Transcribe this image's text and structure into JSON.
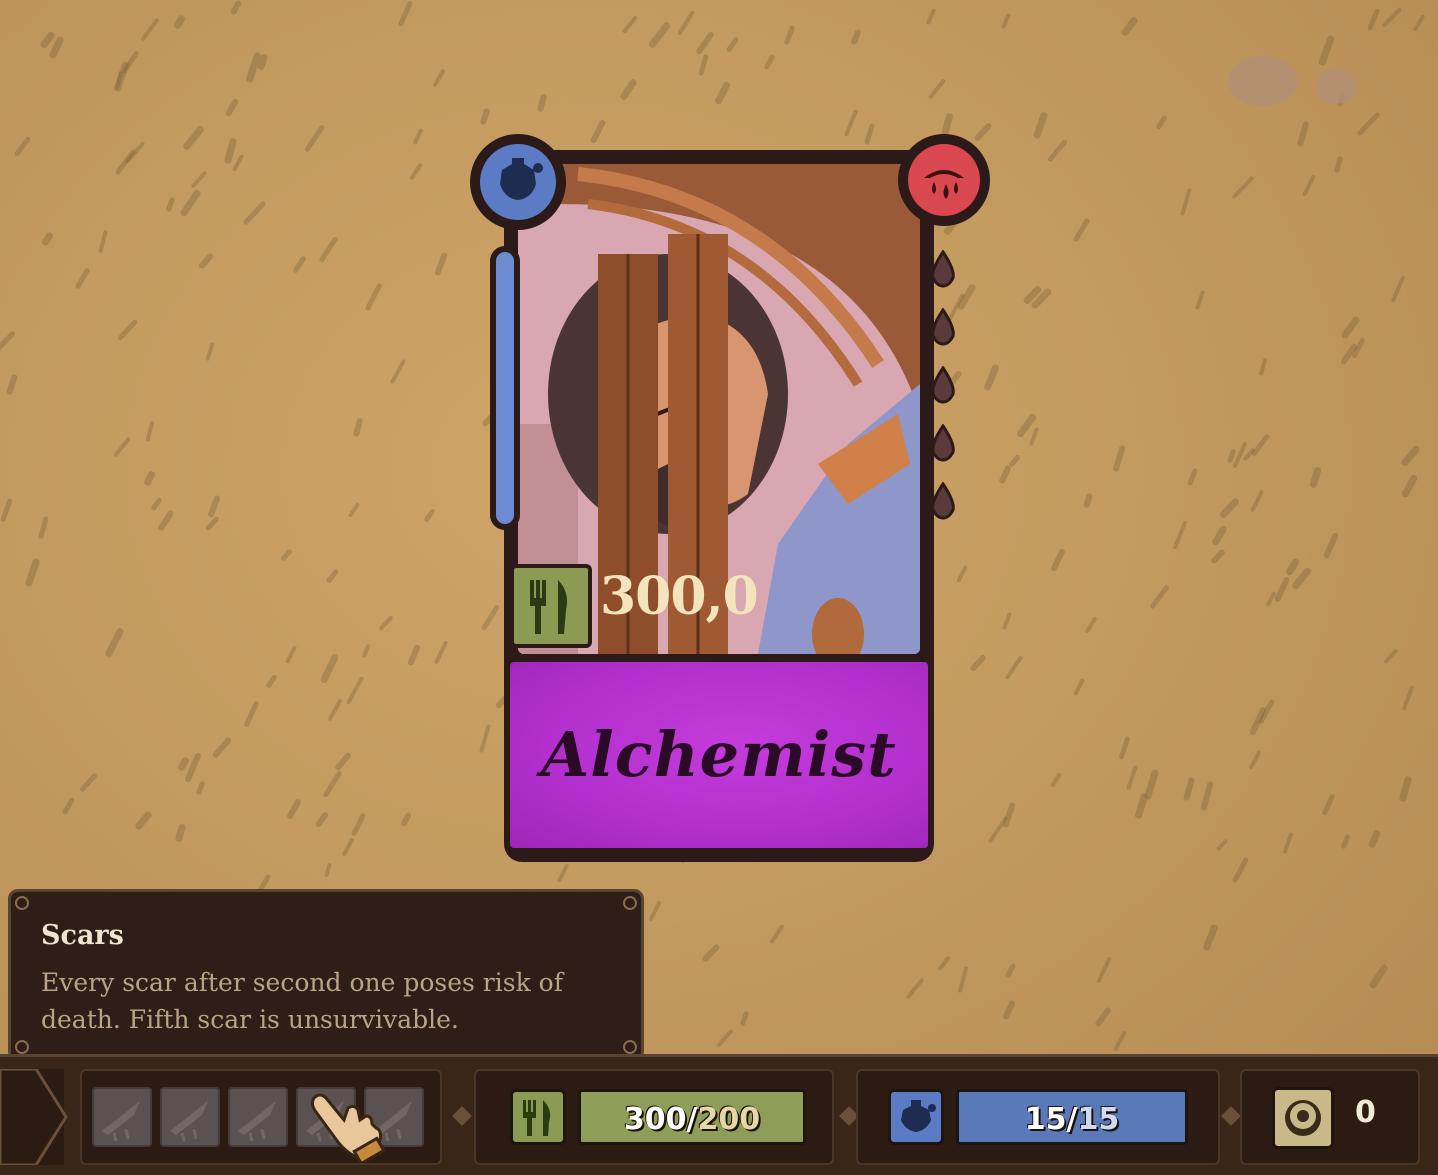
{
  "card": {
    "name": "Alchemist",
    "cost_value": "300,0",
    "cost_icon": "fork-knife-icon",
    "health_icon": "health-flask-icon",
    "blood_icon": "blood-drops-icon",
    "colors": {
      "name_plate": "#b22fcd",
      "health": "#5b7cc4",
      "blood": "#d9484f",
      "cost_chip": "#8c9b53"
    }
  },
  "tooltip": {
    "title": "Scars",
    "description": "Every scar after second one poses risk of death. Fifth scar is unsurvivable."
  },
  "bottom_bar": {
    "scars": {
      "slots": 5,
      "filled": 0,
      "icon": "scar-icon"
    },
    "food": {
      "current": "300",
      "max": "200",
      "icon": "fork-knife-icon"
    },
    "health": {
      "current": "15",
      "max": "15",
      "icon": "health-flask-icon"
    },
    "coins": {
      "value": "0",
      "icon": "coin-icon"
    }
  }
}
